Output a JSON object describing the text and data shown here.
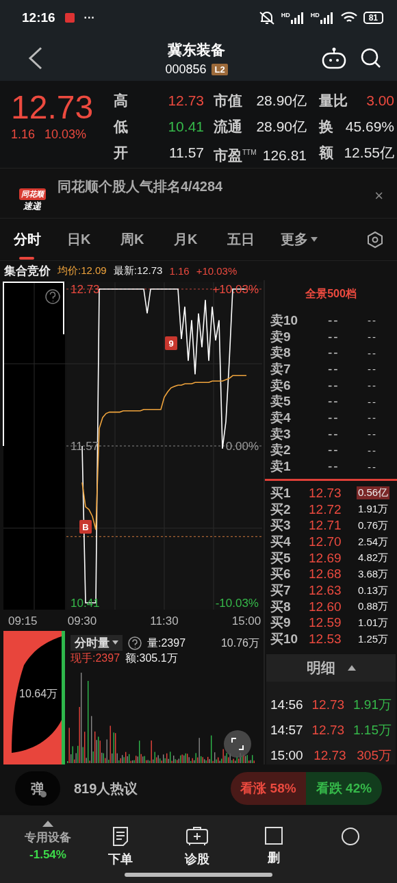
{
  "status_bar": {
    "time": "12:16",
    "more": "···",
    "signals": [
      "HD",
      "HD"
    ],
    "battery": "81"
  },
  "header": {
    "title": "冀东装备",
    "code": "000856",
    "badge": "L2"
  },
  "quote": {
    "price": "12.73",
    "change": "1.16",
    "change_pct": "10.03%",
    "color": "#ec4a3f",
    "stats": [
      {
        "label": "高",
        "value": "12.73",
        "color": "#ec4a3f"
      },
      {
        "label": "市值",
        "value": "28.90亿",
        "color": "#e6e6e6"
      },
      {
        "label": "量比",
        "value": "3.00",
        "color": "#ec4a3f"
      },
      {
        "label": "低",
        "value": "10.41",
        "color": "#36b94a"
      },
      {
        "label": "流通",
        "value": "28.90亿",
        "color": "#e6e6e6"
      },
      {
        "label": "换",
        "value": "45.69%",
        "color": "#e6e6e6"
      },
      {
        "label": "开",
        "value": "11.57",
        "color": "#e6e6e6"
      },
      {
        "label": "市盈$^{TTM}$",
        "value": "126.81",
        "color": "#e6e6e6"
      },
      {
        "label": "额",
        "value": "12.55亿",
        "color": "#e6e6e6"
      }
    ]
  },
  "news": {
    "logo_top": "同花顺",
    "logo_bottom": "速递",
    "text": "同花顺个股人气排名4/4284",
    "close": "×"
  },
  "tabs": [
    {
      "label": "分时",
      "selected": true
    },
    {
      "label": "日K",
      "selected": false
    },
    {
      "label": "周K",
      "selected": false
    },
    {
      "label": "月K",
      "selected": false
    },
    {
      "label": "五日",
      "selected": false
    },
    {
      "label": "更多",
      "selected": false
    }
  ],
  "info_row": {
    "title": "集合竞价",
    "average": "均价:12.09",
    "latest": "最新:12.73",
    "change": "1.16",
    "change_pct": "+10.03%"
  },
  "auction_time": "09:15",
  "chart": {
    "right_labels": [
      "+10.03%",
      "0.00%",
      "-10.03%"
    ],
    "markers": [
      {
        "text": "B"
      },
      {
        "text": "9"
      }
    ],
    "chart_data": {
      "type": "line",
      "ylim": [
        10.41,
        12.73
      ],
      "ref_lines": [
        {
          "axis": "y",
          "value": 12.73,
          "color": "#c0463c"
        },
        {
          "axis": "y",
          "value": 11.57,
          "color": "#888888"
        },
        {
          "axis": "y",
          "value": 10.9,
          "color": "#d0783c"
        }
      ],
      "categories": [
        "09:30",
        null,
        null,
        null,
        null,
        null,
        null,
        null,
        null,
        null,
        null,
        null,
        null,
        null,
        null,
        null,
        null,
        null,
        null,
        null,
        null,
        null,
        null,
        null,
        "11:30",
        null,
        null,
        null,
        null,
        null,
        null,
        null,
        null,
        null,
        null,
        null,
        null,
        null,
        null,
        null,
        null,
        null,
        null,
        null,
        null,
        null,
        null,
        null,
        "15:00"
      ],
      "yticks": [
        {
          "value": 12.73,
          "label": "12.73"
        },
        {
          "value": 11.57,
          "label": "11.57"
        },
        {
          "value": 10.41,
          "label": "10.41"
        }
      ],
      "series": [
        {
          "color": "#ffffff",
          "values": [
            11.57,
            10.41,
            10.41,
            10.41,
            10.41,
            12.73,
            12.73,
            12.73,
            12.73,
            12.73,
            12.73,
            12.73,
            12.73,
            12.73,
            12.73,
            12.73,
            12.73,
            12.73,
            12.73,
            12.55,
            12.73,
            12.73,
            12.73,
            12.73,
            12.73,
            12.73,
            12.73,
            12.73,
            12.73,
            12.36,
            12.6,
            12.2,
            12.5,
            12.1,
            12.55,
            12.3,
            12.65,
            12.2,
            12.6,
            12.35,
            12.5,
            11.55,
            11.75,
            12.2,
            12.73,
            12.73,
            12.73,
            12.73,
            12.73
          ]
        },
        {
          "color": "#f0a43c",
          "values": [
            11.3,
            11.12,
            11.1,
            11.05,
            10.95,
            11.7,
            11.78,
            11.81,
            11.82,
            11.82,
            11.82,
            11.82,
            11.83,
            11.83,
            11.83,
            11.83,
            11.83,
            11.83,
            11.84,
            11.84,
            11.84,
            11.84,
            11.84,
            11.84,
            11.93,
            11.97,
            12.0,
            12.01,
            12.02,
            12.02,
            12.03,
            12.03,
            12.03,
            12.04,
            12.04,
            12.04,
            12.04,
            12.04,
            12.05,
            12.05,
            12.05,
            12.05,
            12.06,
            12.07,
            12.09,
            12.09,
            12.09,
            12.09,
            12.09
          ]
        }
      ]
    }
  },
  "volume": {
    "auction_label": "10.64万",
    "selector": "分时量",
    "volume": "量:2397",
    "max": "10.76万",
    "current": "现手:2397",
    "amount": "额:305.1万"
  },
  "order_book": {
    "title": "全景500档",
    "sells": [
      {
        "label": "卖10",
        "price": "--",
        "volume": "--"
      },
      {
        "label": "卖9",
        "price": "--",
        "volume": "--"
      },
      {
        "label": "卖8",
        "price": "--",
        "volume": "--"
      },
      {
        "label": "卖7",
        "price": "--",
        "volume": "--"
      },
      {
        "label": "卖6",
        "price": "--",
        "volume": "--"
      },
      {
        "label": "卖5",
        "price": "--",
        "volume": "--"
      },
      {
        "label": "卖4",
        "price": "--",
        "volume": "--"
      },
      {
        "label": "卖3",
        "price": "--",
        "volume": "--"
      },
      {
        "label": "卖2",
        "price": "--",
        "volume": "--"
      },
      {
        "label": "卖1",
        "price": "--",
        "volume": "--"
      }
    ],
    "buys": [
      {
        "label": "买1",
        "price": "12.73",
        "volume": "0.56亿",
        "highlighted": true
      },
      {
        "label": "买2",
        "price": "12.72",
        "volume": "1.91万",
        "highlighted": false
      },
      {
        "label": "买3",
        "price": "12.71",
        "volume": "0.76万",
        "highlighted": false
      },
      {
        "label": "买4",
        "price": "12.70",
        "volume": "2.54万",
        "highlighted": false
      },
      {
        "label": "买5",
        "price": "12.69",
        "volume": "4.82万",
        "highlighted": false
      },
      {
        "label": "买6",
        "price": "12.68",
        "volume": "3.68万",
        "highlighted": false
      },
      {
        "label": "买7",
        "price": "12.63",
        "volume": "0.13万",
        "highlighted": false
      },
      {
        "label": "买8",
        "price": "12.60",
        "volume": "0.88万",
        "highlighted": false
      },
      {
        "label": "买9",
        "price": "12.59",
        "volume": "1.01万",
        "highlighted": false
      },
      {
        "label": "买10",
        "price": "12.53",
        "volume": "1.25万",
        "highlighted": false
      }
    ]
  },
  "trades": {
    "title": "明细",
    "rows": [
      {
        "time": "14:56",
        "price": "12.73",
        "volume": "1.91万",
        "kind": "sell"
      },
      {
        "time": "14:57",
        "price": "12.73",
        "volume": "1.15万",
        "kind": "sell"
      },
      {
        "time": "15:00",
        "price": "12.73",
        "volume": "305万",
        "kind": "buy"
      }
    ]
  },
  "discussion": {
    "button": "弹",
    "text": "819人热议",
    "bull": "看涨 58%",
    "bear": "看跌 42%"
  },
  "bottom_nav": {
    "sector": "专用设备",
    "sector_change": "-1.54%",
    "items": [
      {
        "label": "下单",
        "kind": "order"
      },
      {
        "label": "诊股",
        "kind": "diagnose"
      },
      {
        "label": "删",
        "kind": "delete"
      },
      {
        "kind": "more"
      }
    ]
  }
}
